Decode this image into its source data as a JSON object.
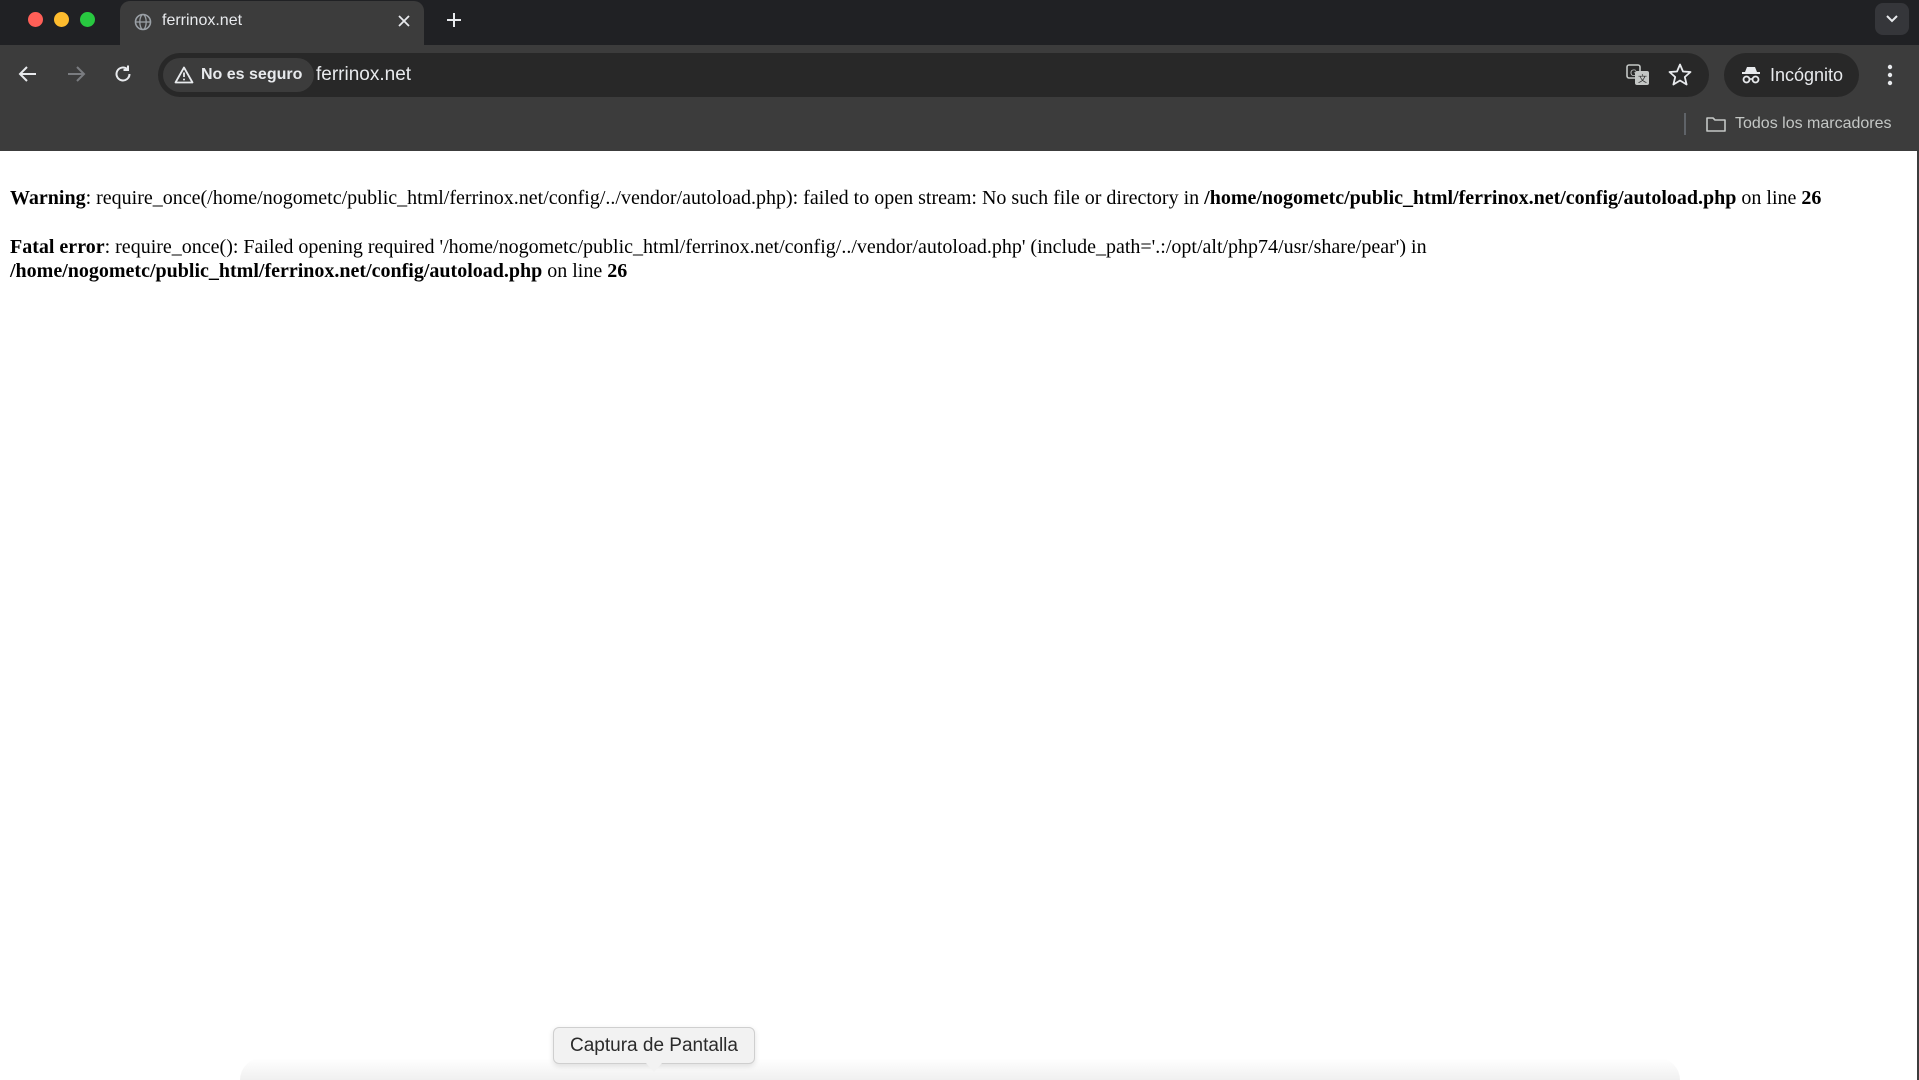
{
  "browser": {
    "tab": {
      "title": "ferrinox.net"
    },
    "omnibox": {
      "security_label": "No es seguro",
      "url": "ferrinox.net"
    },
    "profile_label": "Incógnito",
    "bookmarks": {
      "all_label": "Todos los marcadores"
    }
  },
  "page": {
    "warning": {
      "label": "Warning",
      "text": ": require_once(/home/nogometc/public_html/ferrinox.net/config/../vendor/autoload.php): failed to open stream: No such file or directory in ",
      "file": "/home/nogometc/public_html/ferrinox.net/config/autoload.php",
      "on_line": " on line ",
      "line": "26"
    },
    "fatal": {
      "label": "Fatal error",
      "text": ": require_once(): Failed opening required '/home/nogometc/public_html/ferrinox.net/config/../vendor/autoload.php' (include_path='.:/opt/alt/php74/usr/share/pear') in",
      "file": "/home/nogometc/public_html/ferrinox.net/config/autoload.php",
      "on_line": " on line ",
      "line": "26"
    }
  },
  "tooltip": {
    "text": "Captura de Pantalla"
  },
  "icons": {
    "window_controls": [
      "close-window-icon",
      "minimize-window-icon",
      "maximize-window-icon"
    ],
    "toolbar": [
      "back-arrow-icon",
      "forward-arrow-icon",
      "reload-icon",
      "warning-triangle-icon",
      "translate-icon",
      "star-icon",
      "incognito-icon",
      "kebab-menu-icon",
      "folder-icon",
      "globe-icon",
      "chevron-down-icon"
    ]
  }
}
